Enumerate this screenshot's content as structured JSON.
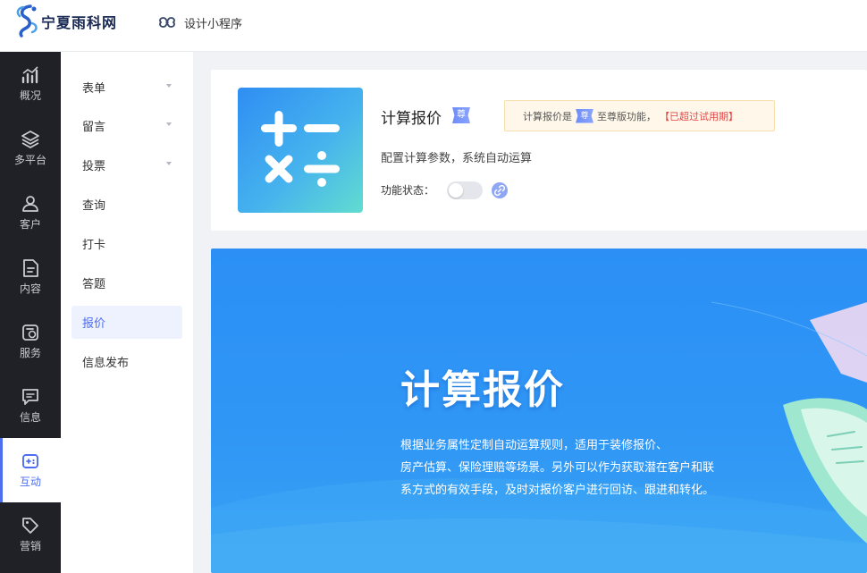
{
  "header": {
    "logo_text": "宁夏雨科网",
    "mini_program_label": "设计小程序"
  },
  "rail": {
    "items": [
      {
        "label": "概况",
        "icon": "chart-icon"
      },
      {
        "label": "多平台",
        "icon": "layers-icon"
      },
      {
        "label": "客户",
        "icon": "user-icon"
      },
      {
        "label": "内容",
        "icon": "document-icon"
      },
      {
        "label": "服务",
        "icon": "service-icon"
      },
      {
        "label": "信息",
        "icon": "message-icon"
      },
      {
        "label": "互动",
        "icon": "interact-icon",
        "active": true
      },
      {
        "label": "营销",
        "icon": "tag-icon"
      }
    ]
  },
  "submenu": {
    "items": [
      {
        "label": "表单",
        "has_caret": true
      },
      {
        "label": "留言",
        "has_caret": true
      },
      {
        "label": "投票",
        "has_caret": true
      },
      {
        "label": "查询"
      },
      {
        "label": "打卡"
      },
      {
        "label": "答题"
      },
      {
        "label": "报价",
        "active": true
      },
      {
        "label": "信息发布"
      }
    ]
  },
  "feature": {
    "title": "计算报价",
    "vip_badge": "尊",
    "notice_prefix": "计算报价是",
    "notice_badge": "尊",
    "notice_suffix": "至尊版功能，",
    "notice_warning": "【已超过试用期】",
    "description": "配置计算参数，系统自动运算",
    "status_label": "功能状态：",
    "enabled": false
  },
  "banner": {
    "title": "计算报价",
    "lines": [
      "根据业务属性定制自动运算规则，适用于装修报价、",
      "房产估算、保险理赔等场景。另外可以作为获取潜在客户和联",
      "系方式的有效手段，及时对报价客户进行回访、跟进和转化。"
    ]
  },
  "colors": {
    "accent": "#4e6ef2",
    "rail_bg": "#202126",
    "warning": "#e54545",
    "banner": "#2b8ff5"
  }
}
